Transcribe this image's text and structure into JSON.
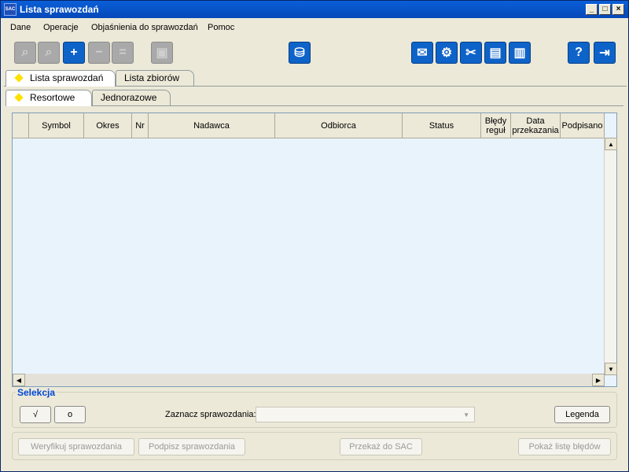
{
  "window": {
    "title": "Lista sprawozdań",
    "app_icon_text": "SAC"
  },
  "menu": [
    "Dane",
    "Operacje",
    "Objaśnienia do sprawozdań",
    "Pomoc"
  ],
  "toolbar": {
    "icons": [
      "zoom-out-icon",
      "search-icon",
      "add-icon",
      "remove-icon",
      "minus-icon",
      "save-icon",
      "database-search-icon",
      "mail-icon",
      "settings-icon",
      "tools-icon",
      "document-icon",
      "report-icon",
      "help-icon",
      "exit-icon"
    ]
  },
  "tabs_main": [
    {
      "label": "Lista sprawozdań",
      "selected": true
    },
    {
      "label": "Lista zbiorów",
      "selected": false
    }
  ],
  "tabs_sub": [
    {
      "label": "Resortowe",
      "selected": true
    },
    {
      "label": "Jednorazowe",
      "selected": false
    }
  ],
  "table": {
    "columns": [
      "",
      "Symbol",
      "Okres",
      "Nr",
      "Nadawca",
      "Odbiorca",
      "Status",
      "Błędy reguł",
      "Data przekazania",
      "Podpisano"
    ],
    "rows": []
  },
  "selection": {
    "title": "Selekcja",
    "check_label": "√",
    "uncheck_label": "o",
    "mark_label": "Zaznacz sprawozdania:",
    "mark_value": "",
    "legend_button": "Legenda"
  },
  "actions": {
    "verify": "Weryfikuj sprawozdania",
    "sign": "Podpisz sprawozdania",
    "transfer": "Przekaż do SAC",
    "show_errors": "Pokaż listę błędów"
  }
}
